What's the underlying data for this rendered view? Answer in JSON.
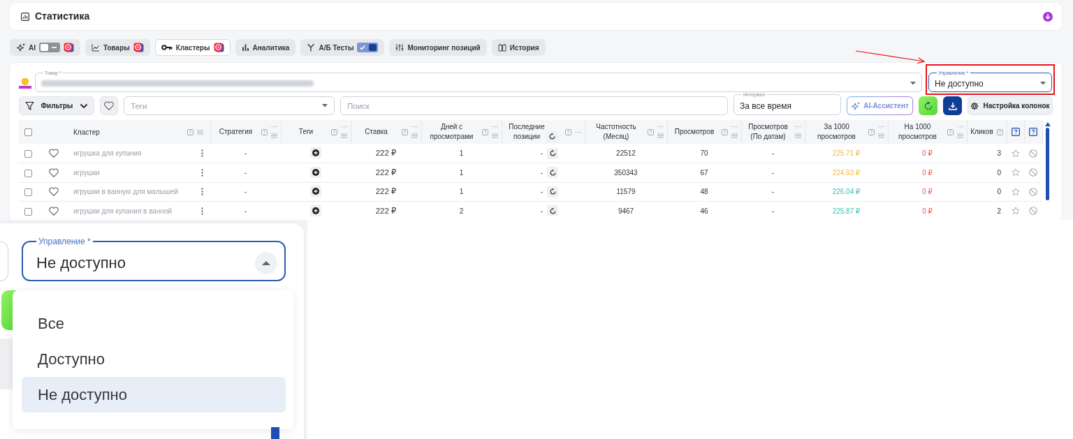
{
  "header": {
    "title": "Статистика"
  },
  "tabs": [
    {
      "label": "AI",
      "selected": false,
      "toggle": {
        "on": false
      },
      "badge": true
    },
    {
      "label": "Товары",
      "selected": false,
      "badge": true
    },
    {
      "label": "Кластеры",
      "selected": true,
      "badge": true
    },
    {
      "label": "Аналитика",
      "selected": false
    },
    {
      "label": "А/Б Тесты",
      "selected": false,
      "toggle": {
        "on": true
      }
    },
    {
      "label": "Мониторинг позиций",
      "selected": false
    },
    {
      "label": "История",
      "selected": false
    }
  ],
  "product_field": {
    "label": "Товар *"
  },
  "management_field": {
    "label": "Управление *",
    "value": "Не доступно",
    "expanded": false
  },
  "toolbar": {
    "filters_button": {
      "label": "Фильтры"
    },
    "tags_select": {
      "placeholder": "Теги"
    },
    "search": {
      "placeholder": "Поиск"
    },
    "interval": {
      "label": "Интервал",
      "value": "За все время"
    },
    "ai_button": {
      "label": "AI-Ассистент"
    },
    "columns_button": {
      "label": "Настройка колонок"
    }
  },
  "table": {
    "select_all": {
      "checked": false
    },
    "columns": [
      {
        "kind": "select"
      },
      {
        "kind": "favorite"
      },
      {
        "label": "Кластер",
        "kind": "cluster"
      },
      {
        "label": "Стратегия",
        "kind": "strategy"
      },
      {
        "label": "Теги",
        "kind": "tags"
      },
      {
        "label": "Ставка",
        "kind": "bid"
      },
      {
        "label": "Дней с просмотрами",
        "kind": "days"
      },
      {
        "label": "Последние позиции",
        "kind": "positions"
      },
      {
        "label": "Частотность (Месяц)",
        "kind": "frequency"
      },
      {
        "label": "Просмотров",
        "kind": "views"
      },
      {
        "label": "Просмотров (По датам)",
        "kind": "views_by_dates"
      },
      {
        "label": "За 1000 просмотров",
        "kind": "per_1000"
      },
      {
        "label": "На 1000 просмотров",
        "kind": "on_1000"
      },
      {
        "label": "Кликов",
        "kind": "clicks"
      },
      {
        "kind": "star"
      },
      {
        "kind": "block"
      }
    ],
    "rows": [
      {
        "checked": false,
        "favorite": false,
        "cluster": "игрушка для купания",
        "strategy": "-",
        "bid": "222 ₽",
        "days": "1",
        "positions": "-",
        "frequency": "22512",
        "views": "70",
        "views_by_dates": "-",
        "per_1000": {
          "text": "225.71 ₽",
          "color": "#f5b73b"
        },
        "on_1000": "0 ₽",
        "clicks": "3",
        "star": false
      },
      {
        "checked": false,
        "favorite": false,
        "cluster": "игрушки",
        "strategy": "-",
        "bid": "222 ₽",
        "days": "1",
        "positions": "-",
        "frequency": "350343",
        "views": "67",
        "views_by_dates": "-",
        "per_1000": {
          "text": "224.93 ₽",
          "color": "#f5b73b"
        },
        "on_1000": "0 ₽",
        "clicks": "0",
        "star": false
      },
      {
        "checked": false,
        "favorite": false,
        "cluster": "игрушки в ванную для малышей",
        "strategy": "-",
        "bid": "222 ₽",
        "days": "1",
        "positions": "-",
        "frequency": "11579",
        "views": "48",
        "views_by_dates": "-",
        "per_1000": {
          "text": "226.04 ₽",
          "color": "#38bdb5"
        },
        "on_1000": "0 ₽",
        "clicks": "0",
        "star": false
      },
      {
        "checked": false,
        "favorite": false,
        "cluster": "игрушки для купания в ванной",
        "strategy": "-",
        "bid": "222 ₽",
        "days": "2",
        "positions": "-",
        "frequency": "9467",
        "views": "46",
        "views_by_dates": "-",
        "per_1000": {
          "text": "225.87 ₽",
          "color": "#38bdb5"
        },
        "on_1000": "0 ₽",
        "clicks": "2",
        "star": false
      }
    ]
  },
  "inset": {
    "field": {
      "label": "Управление *",
      "value": "Не доступно",
      "expanded": true
    },
    "options": [
      {
        "label": "Все",
        "selected": false
      },
      {
        "label": "Доступно",
        "selected": false
      },
      {
        "label": "Не доступно",
        "selected": true
      }
    ]
  }
}
